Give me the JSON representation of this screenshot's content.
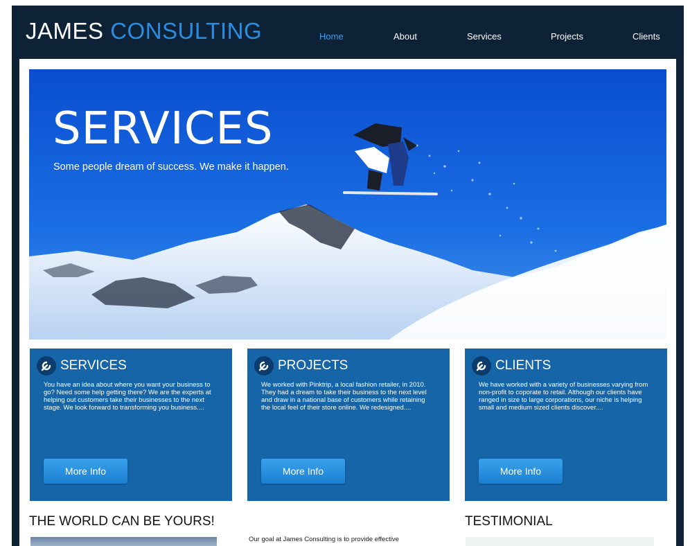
{
  "header": {
    "logo_part1": "JAMES",
    "logo_part2": "CONSULTING",
    "nav": [
      "Home",
      "About",
      "Services",
      "Projects",
      "Clients"
    ],
    "active_nav": "Home"
  },
  "hero": {
    "title": "SERVICES",
    "subtitle": "Some people dream of success. We make it happen."
  },
  "cards": [
    {
      "title": "SERVICES",
      "text": "You have an idea about where you want your business to go? Need some help getting there? We are the experts at helping out customers take their businesses to the next stage. We look forward to transforming you business....",
      "button": "More Info"
    },
    {
      "title": "PROJECTS",
      "text": "We worked with Pinktrip, a local fashion retailer, in 2010. They had a dream to take their business to the next level and draw in a national base of customers while retaining the local feel of their store online. We redesigned....",
      "button": "More Info"
    },
    {
      "title": "CLIENTS",
      "text": "We have worked with a variety of businesses varying from non-profit to coporate to retail. Although our clients have ranged in size to large corporations, our niche is helping small and medium sized clients discover....",
      "button": "More Info"
    }
  ],
  "world": {
    "heading": "THE WORLD CAN BE YOURS!"
  },
  "goal": {
    "text": "Our goal at James Consulting is to provide effective"
  },
  "testimonial": {
    "heading": "TESTIMONIAL"
  },
  "colors": {
    "frame": "#0d2236",
    "accent": "#2a8de0",
    "card": "#1565a8"
  }
}
